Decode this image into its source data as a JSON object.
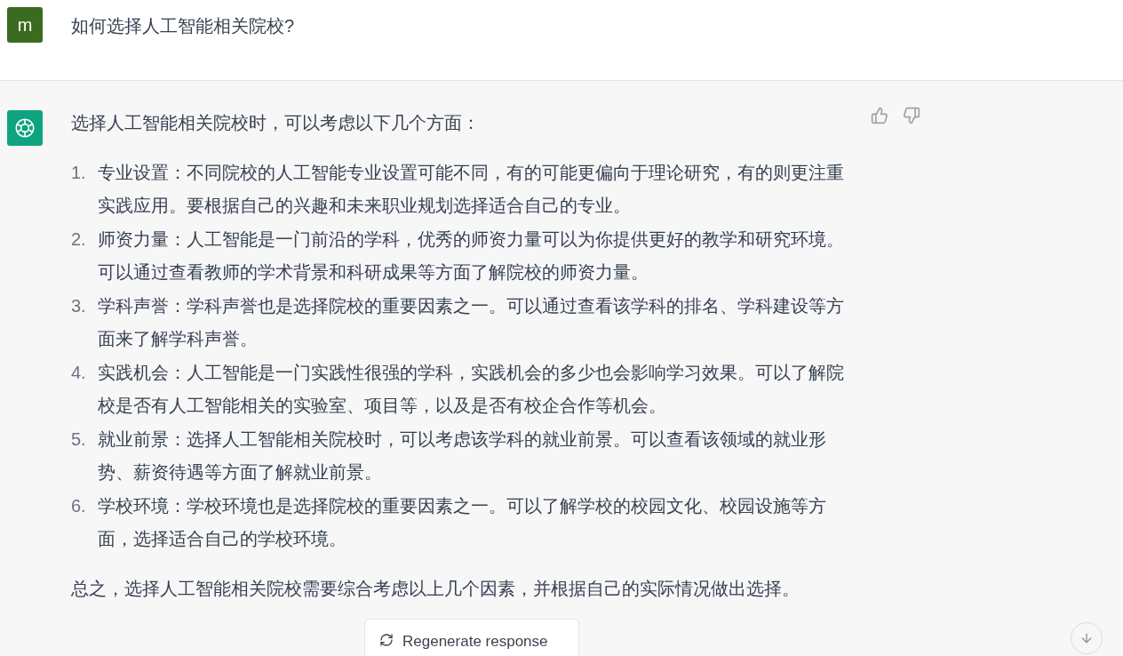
{
  "user_message": {
    "avatar": "m",
    "text": "如何选择人工智能相关院校?"
  },
  "response": {
    "intro": "选择人工智能相关院校时，可以考虑以下几个方面：",
    "items": [
      {
        "number": "1.",
        "text": "专业设置：不同院校的人工智能专业设置可能不同，有的可能更偏向于理论研究，有的则更注重实践应用。要根据自己的兴趣和未来职业规划选择适合自己的专业。"
      },
      {
        "number": "2.",
        "text": "师资力量：人工智能是一门前沿的学科，优秀的师资力量可以为你提供更好的教学和研究环境。可以通过查看教师的学术背景和科研成果等方面了解院校的师资力量。"
      },
      {
        "number": "3.",
        "text": "学科声誉：学科声誉也是选择院校的重要因素之一。可以通过查看该学科的排名、学科建设等方面来了解学科声誉。"
      },
      {
        "number": "4.",
        "text": "实践机会：人工智能是一门实践性很强的学科，实践机会的多少也会影响学习效果。可以了解院校是否有人工智能相关的实验室、项目等，以及是否有校企合作等机会。"
      },
      {
        "number": "5.",
        "text": "就业前景：选择人工智能相关院校时，可以考虑该学科的就业前景。可以查看该领域的就业形势、薪资待遇等方面了解就业前景。"
      },
      {
        "number": "6.",
        "text": "学校环境：学校环境也是选择院校的重要因素之一。可以了解学校的校园文化、校园设施等方面，选择适合自己的学校环境。"
      }
    ],
    "conclusion": "总之，选择人工智能相关院校需要综合考虑以上几个因素，并根据自己的实际情况做出选择。"
  },
  "regenerate_button": {
    "label": "Regenerate response"
  }
}
